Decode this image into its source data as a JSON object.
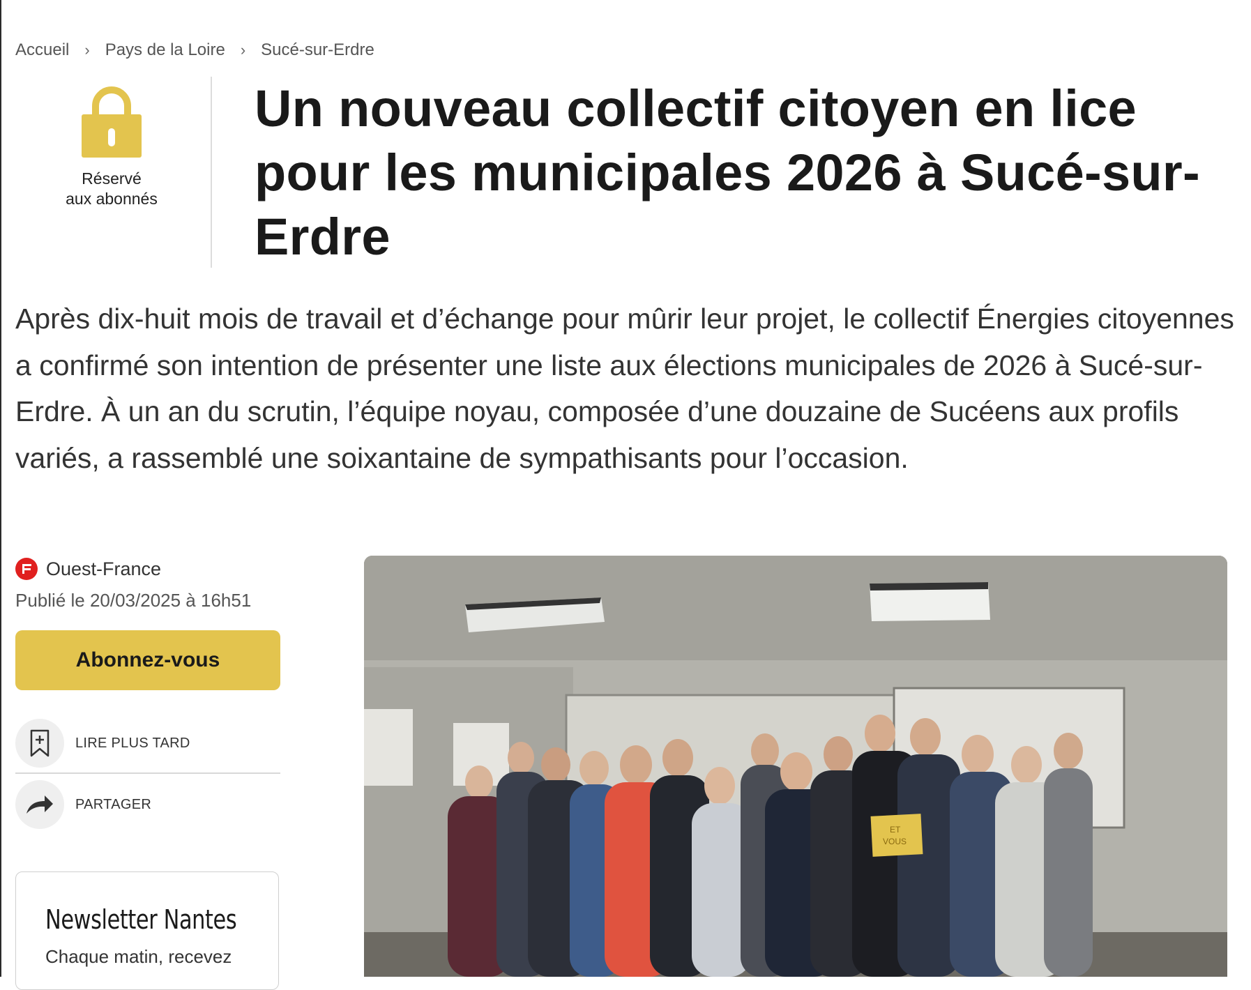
{
  "breadcrumb": {
    "items": [
      "Accueil",
      "Pays de la Loire",
      "Sucé-sur-Erdre"
    ]
  },
  "premium": {
    "label": "Réservé\naux abonnés",
    "icon": "lock-icon",
    "color": "#e3c44e"
  },
  "article": {
    "title": "Un nouveau collectif citoyen en lice pour les municipales 2026 à Sucé-sur-Erdre",
    "lead": "Après dix-huit mois de travail et d’échange pour mûrir leur projet, le collectif Énergies citoyennes a confirmé son intention de présenter une liste aux élections municipales de 2026 à Sucé-sur-Erdre. À un an du scrutin, l’équipe noyau, composée d’une douzaine de Sucéens aux profils variés, a rassemblé une soixantaine de sympathisants pour l’occasion."
  },
  "meta": {
    "source": "Ouest-France",
    "source_color": "#e0201f",
    "published": "Publié le 20/03/2025 à 16h51"
  },
  "actions": {
    "subscribe_label": "Abonnez-vous",
    "subscribe_color": "#e3c44e",
    "read_later_label": "LIRE PLUS TARD",
    "read_later_icon": "bookmark-add-icon",
    "share_label": "PARTAGER",
    "share_icon": "share-arrow-icon"
  },
  "newsletter": {
    "title": "Newsletter Nantes",
    "description": "Chaque matin, recevez"
  },
  "photo": {
    "sign_text_1": "ET",
    "sign_text_2": "VOUS"
  }
}
